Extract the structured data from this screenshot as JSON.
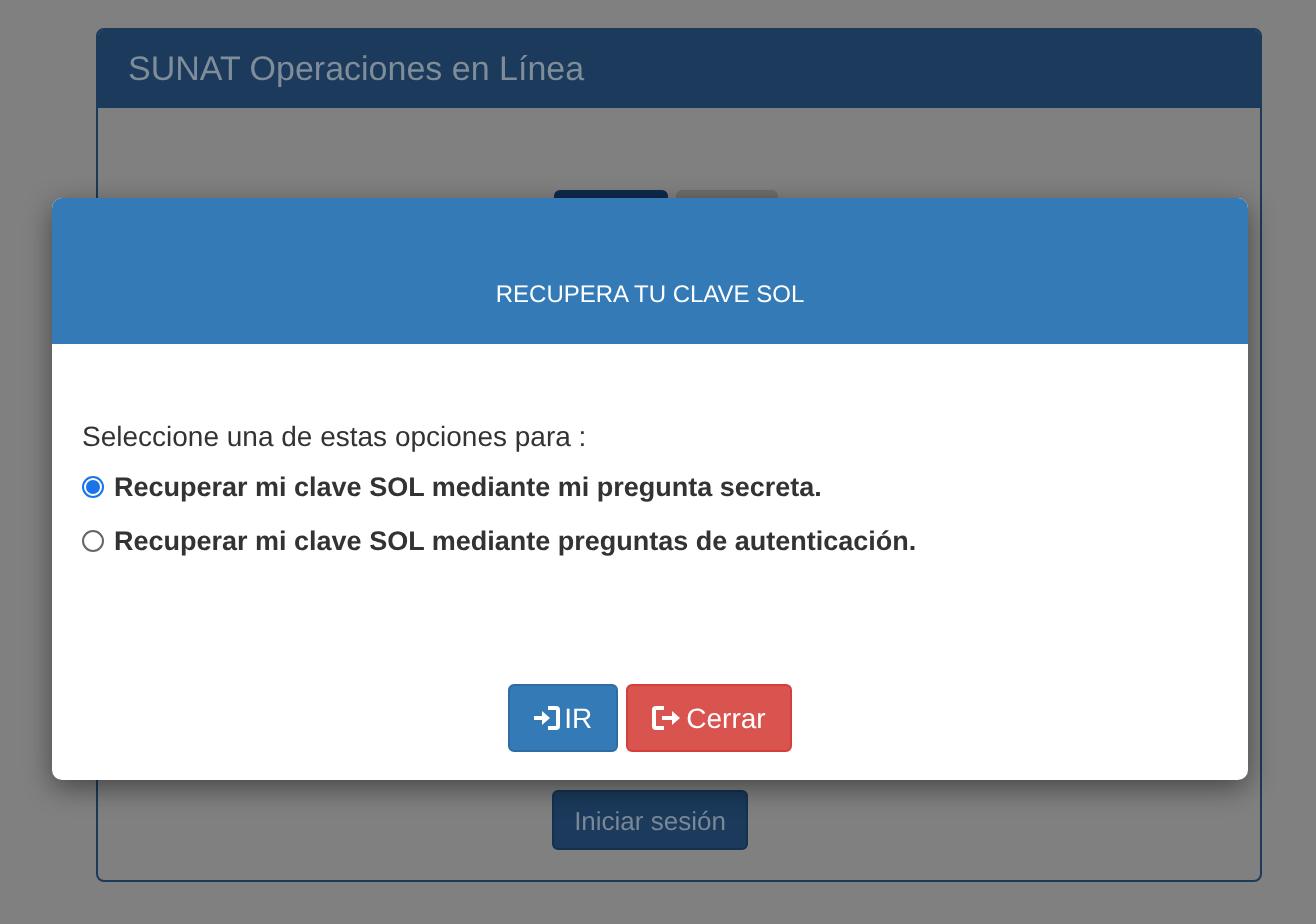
{
  "background_panel": {
    "title": "SUNAT Operaciones en Línea",
    "tabs": [
      {
        "selected": true
      },
      {
        "selected": false
      }
    ],
    "button": "Iniciar sesión"
  },
  "dialog": {
    "title": "RECUPERA TU CLAVE SOL",
    "prompt": "Seleccione una de estas opciones para :",
    "options": [
      {
        "label": "Recuperar mi clave SOL mediante mi pregunta secreta.",
        "selected": true
      },
      {
        "label": "Recuperar mi clave SOL mediante preguntas de autenticación.",
        "selected": false
      }
    ],
    "buttons": [
      {
        "label": "IR",
        "kind": "primary"
      },
      {
        "label": "Cerrar",
        "kind": "danger"
      }
    ]
  }
}
